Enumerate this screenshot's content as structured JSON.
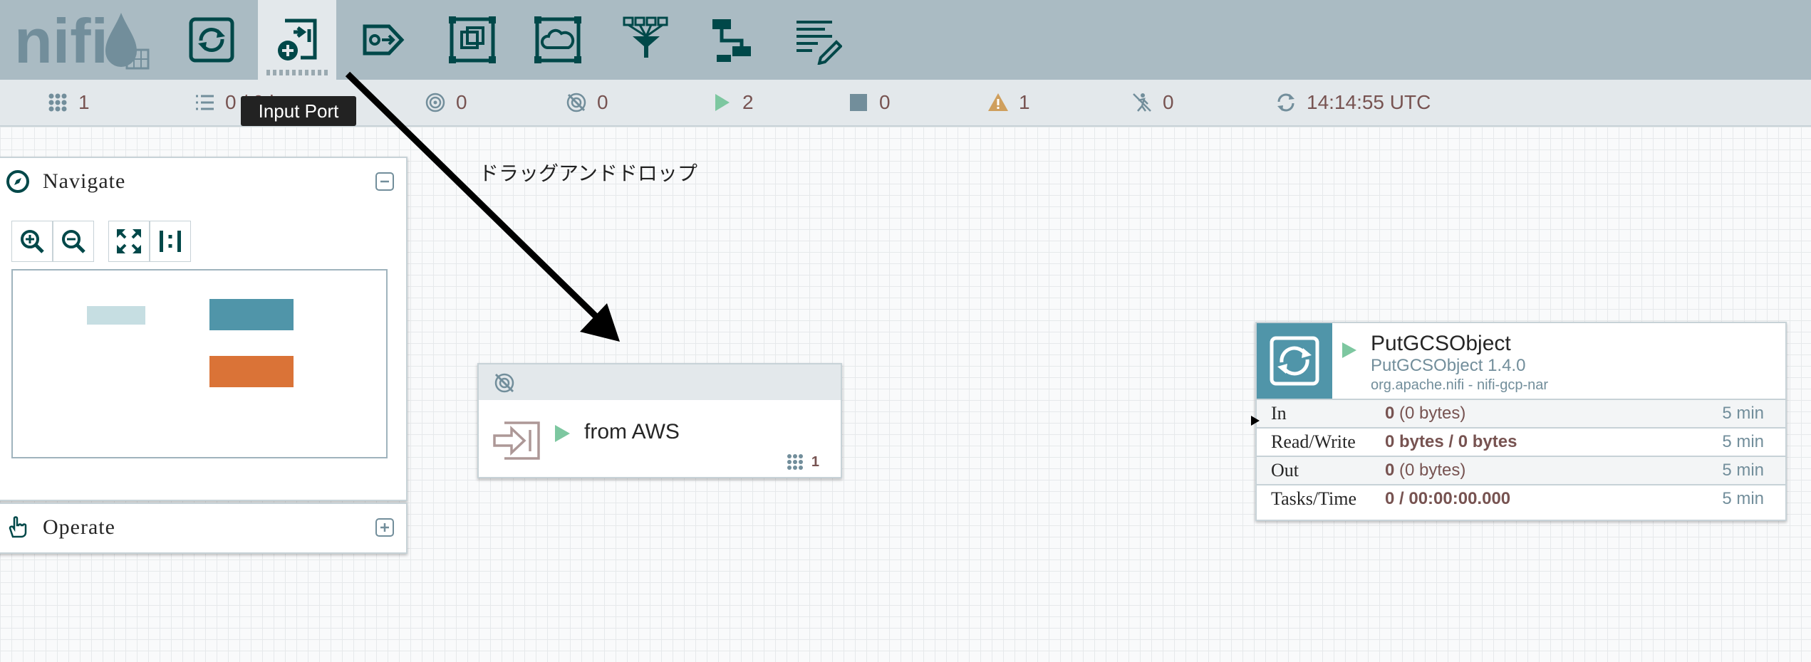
{
  "app": {
    "logo_text": "nifi"
  },
  "toolbar": {
    "buttons": [
      {
        "name": "processor-button",
        "icon": "processor-icon"
      },
      {
        "name": "input-port-button",
        "icon": "input-port-icon",
        "active": true
      },
      {
        "name": "output-port-button",
        "icon": "output-port-icon"
      },
      {
        "name": "process-group-button",
        "icon": "process-group-icon"
      },
      {
        "name": "remote-process-group-button",
        "icon": "remote-process-group-icon"
      },
      {
        "name": "funnel-button",
        "icon": "funnel-icon"
      },
      {
        "name": "template-button",
        "icon": "template-icon"
      },
      {
        "name": "label-button",
        "icon": "label-icon"
      }
    ],
    "tooltip": "Input Port"
  },
  "status": {
    "active_threads": "1",
    "queued": "0 / 0 by",
    "transmitting": "0",
    "not_transmitting": "0",
    "running": "2",
    "stopped": "0",
    "invalid": "1",
    "disabled": "0",
    "last_refresh": "14:14:55 UTC"
  },
  "annotation": {
    "text": "ドラッグアンドドロップ"
  },
  "navigate_panel": {
    "title": "Navigate"
  },
  "operate_panel": {
    "title": "Operate"
  },
  "input_port": {
    "name": "from AWS",
    "active_threads": "1"
  },
  "processor": {
    "name": "PutGCSObject",
    "type": "PutGCSObject 1.4.0",
    "bundle": "org.apache.nifi - nifi-gcp-nar",
    "stats": [
      {
        "label": "In",
        "count": "0",
        "detail": " (0 bytes)",
        "time": "5 min"
      },
      {
        "label": "Read/Write",
        "count": "0 bytes / 0 bytes",
        "detail": "",
        "time": "5 min"
      },
      {
        "label": "Out",
        "count": "0",
        "detail": " (0 bytes)",
        "time": "5 min"
      },
      {
        "label": "Tasks/Time",
        "count": "0 / 00:00:00.000",
        "detail": "",
        "time": "5 min"
      }
    ]
  },
  "colors": {
    "toolbar": "#aabbc3",
    "accent": "#5095a9",
    "running": "#7dc7a0",
    "value": "#775351"
  }
}
